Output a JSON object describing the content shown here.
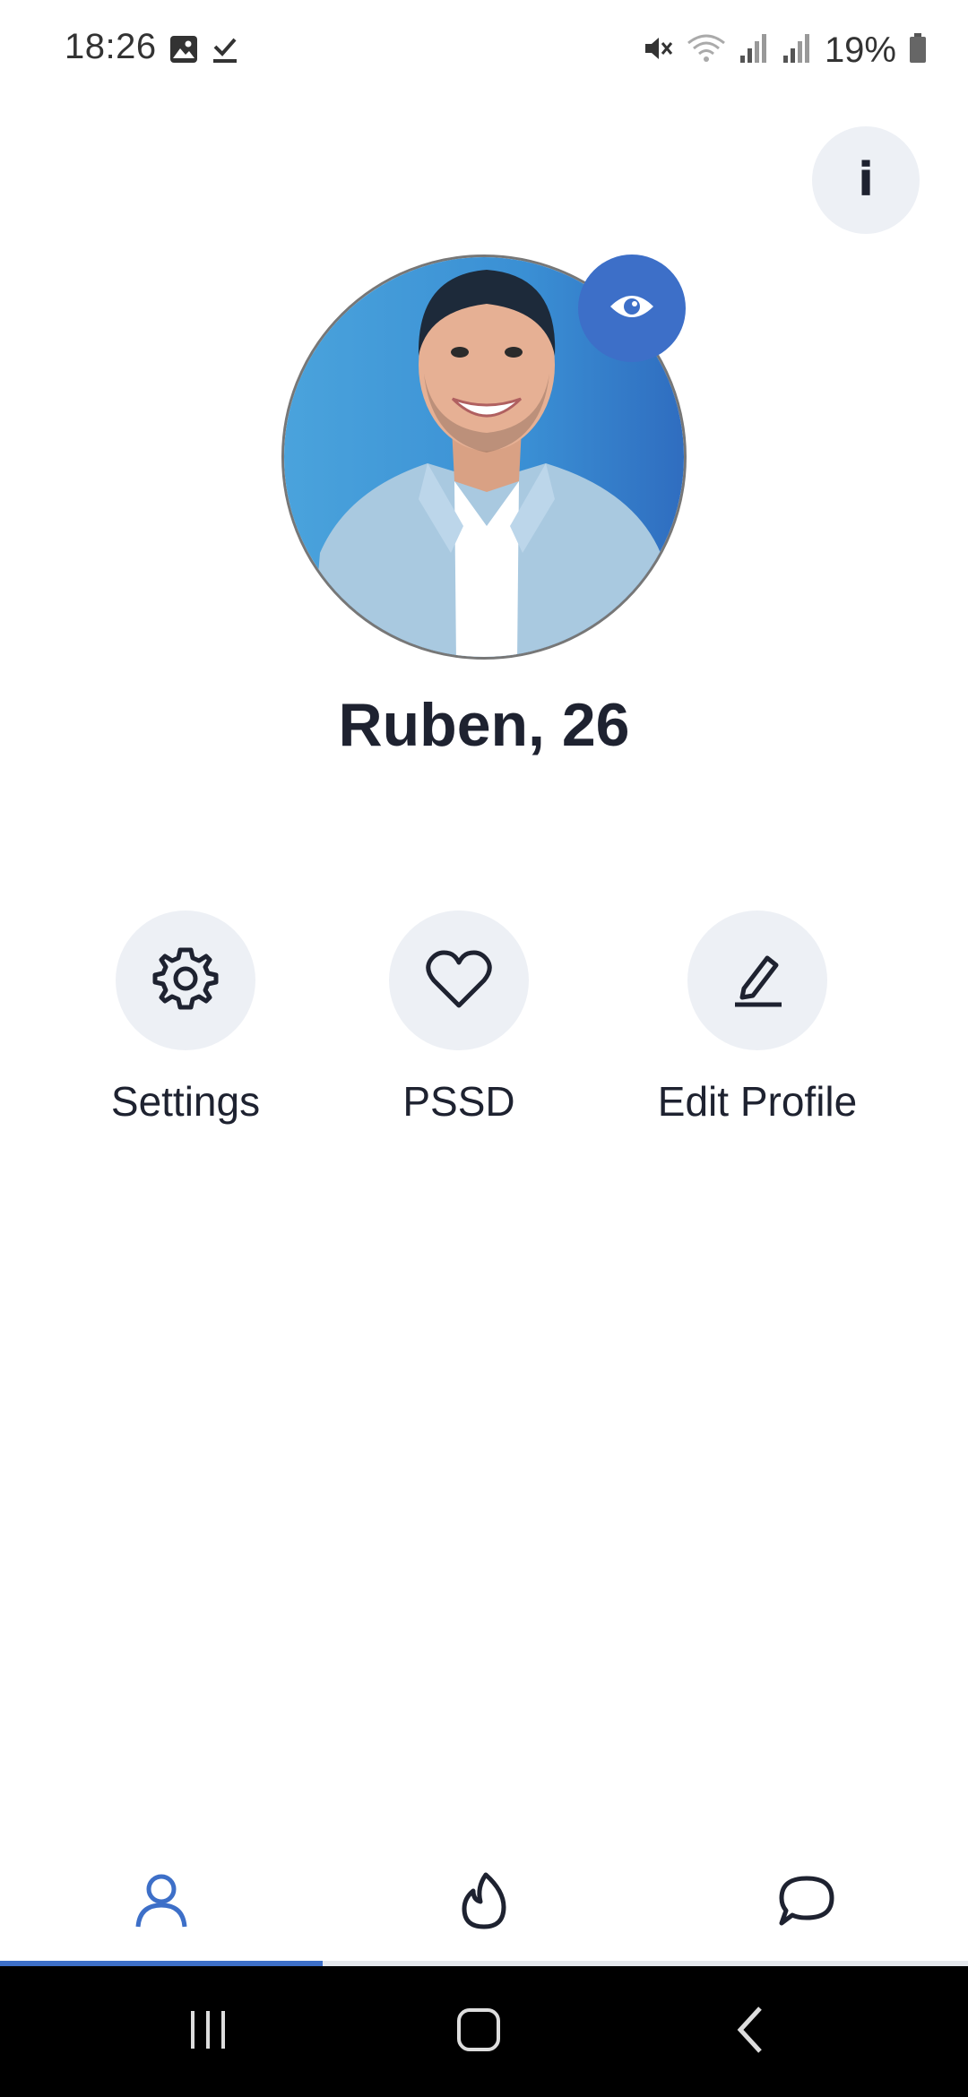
{
  "status_bar": {
    "time": "18:26",
    "battery_text": "19%",
    "icons": [
      "image-icon",
      "download-done-icon",
      "mute-icon",
      "wifi-icon",
      "signal-icon",
      "signal-icon-2",
      "battery-icon"
    ]
  },
  "profile": {
    "name_age": "Ruben, 26",
    "info_label": "i"
  },
  "actions": [
    {
      "label": "Settings",
      "icon": "gear-icon"
    },
    {
      "label": "PSSD",
      "icon": "heart-icon"
    },
    {
      "label": "Edit Profile",
      "icon": "pencil-icon"
    }
  ],
  "bottom_nav": {
    "items": [
      "profile-icon",
      "flame-icon",
      "chat-icon"
    ],
    "active": "profile"
  },
  "colors": {
    "accent": "#3d6fc8",
    "button_bg": "#edf0f5",
    "text": "#1e2230"
  }
}
